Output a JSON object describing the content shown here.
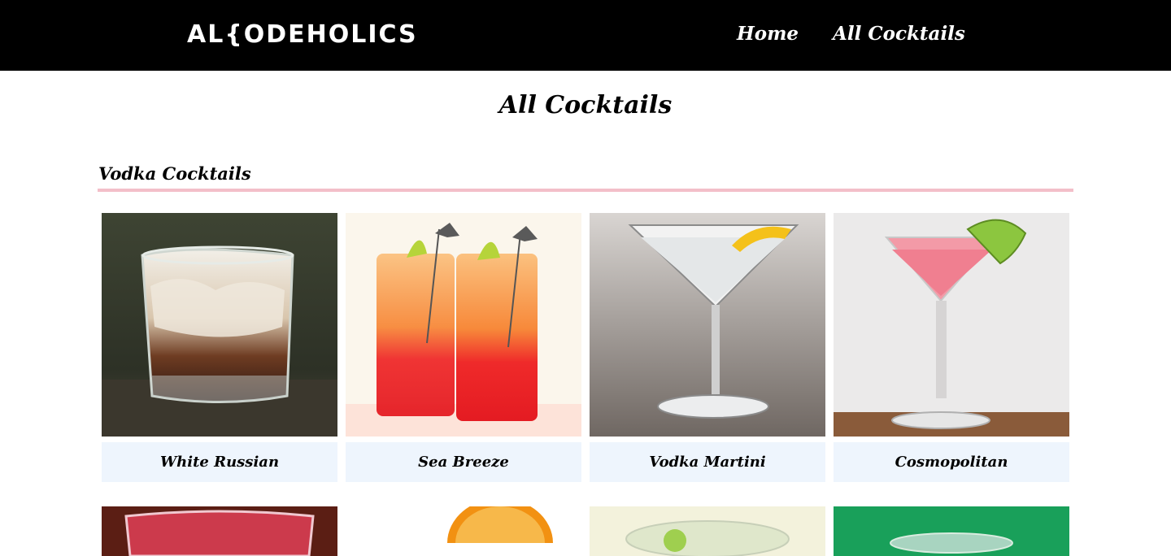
{
  "header": {
    "logo_text": "AL{ODEHOLICS",
    "nav": [
      {
        "label": "Home"
      },
      {
        "label": "All Cocktails"
      }
    ]
  },
  "page": {
    "title": "All Cocktails"
  },
  "sections": [
    {
      "title": "Vodka Cocktails",
      "cards": [
        {
          "name": "White Russian"
        },
        {
          "name": "Sea Breeze"
        },
        {
          "name": "Vodka Martini"
        },
        {
          "name": "Cosmopolitan"
        }
      ]
    }
  ],
  "colors": {
    "header_bg": "#000000",
    "section_rule": "#f3bfc9",
    "card_label_bg": "#eef5fd"
  }
}
